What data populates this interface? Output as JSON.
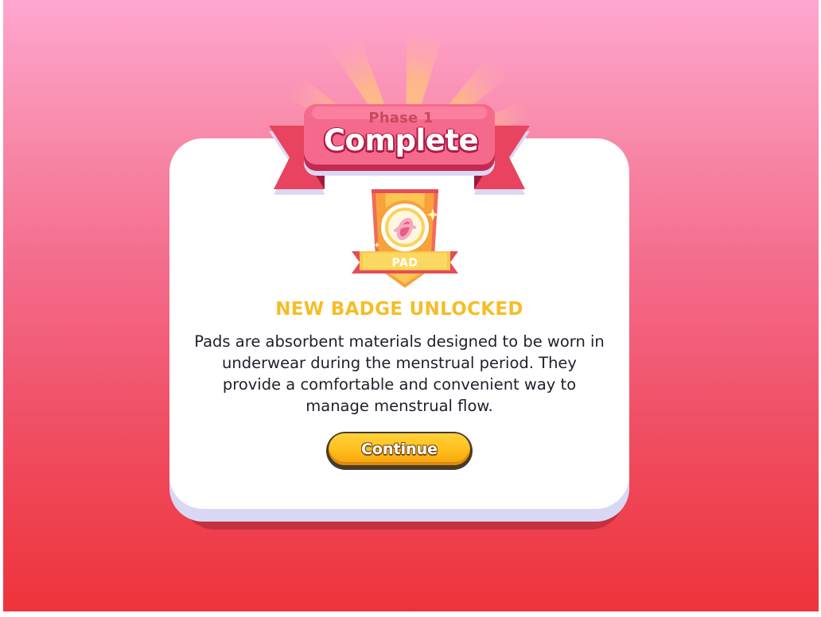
{
  "header": {
    "phase_label": "Phase 1",
    "title": "Complete"
  },
  "badge": {
    "label": "PAD",
    "icon": "pad-icon"
  },
  "unlock_heading": "NEW BADGE UNLOCKED",
  "description": "Pads are absorbent materials designed to be worn in underwear during the menstrual period. They provide a comfortable and convenient way to manage menstrual flow.",
  "button": {
    "label": "Continue"
  },
  "colors": {
    "background_top": "#ffa6cf",
    "background_bottom": "#ee333b",
    "ribbon": "#f45a7e",
    "heading": "#f5bd26",
    "button": "#ffc01e"
  }
}
